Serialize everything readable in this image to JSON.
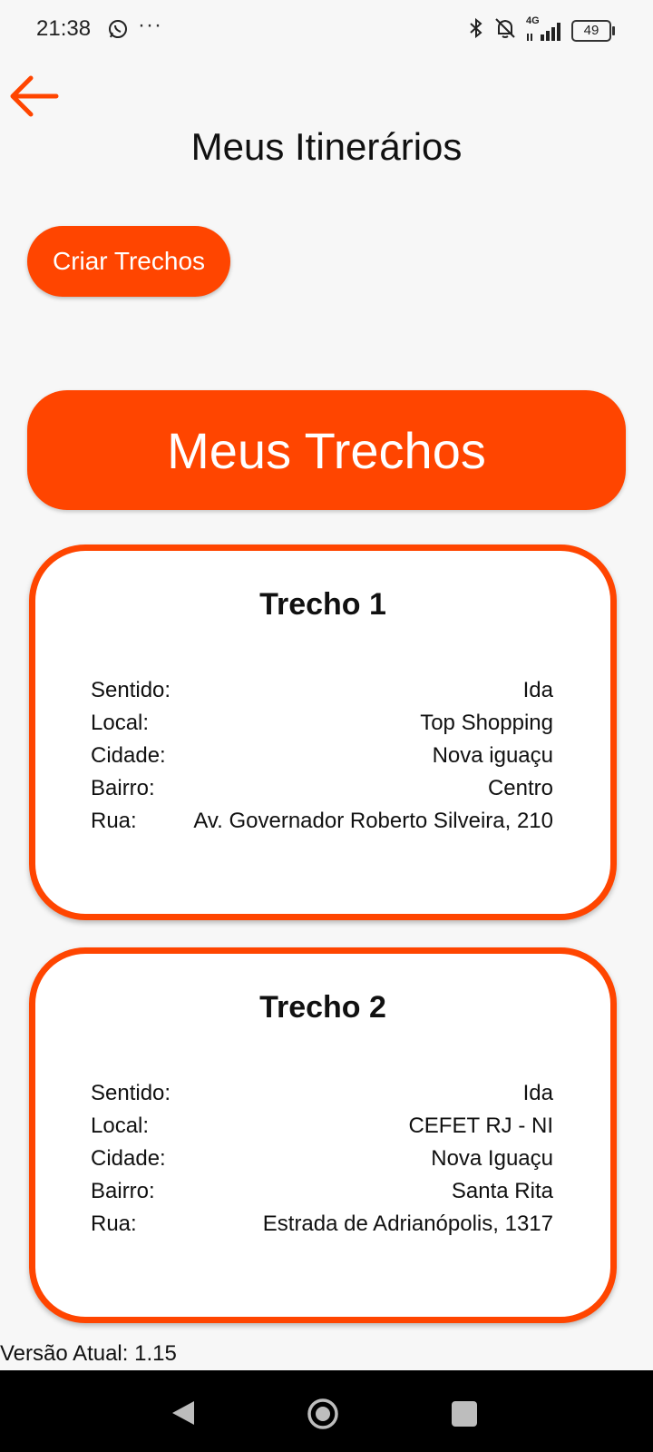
{
  "status_bar": {
    "time": "21:38",
    "more": "···",
    "network": "4G",
    "battery": "49",
    "icons": [
      "whatsapp-icon",
      "bluetooth-icon",
      "bell-off-icon",
      "signal-icon",
      "battery-icon"
    ]
  },
  "header": {
    "back_icon": "arrow-left-icon",
    "title": "Meus Itinerários"
  },
  "actions": {
    "create_label": "Criar Trechos"
  },
  "section": {
    "title": "Meus Trechos"
  },
  "cards": [
    {
      "title": "Trecho 1",
      "rows": [
        {
          "label": "Sentido:",
          "value": "Ida"
        },
        {
          "label": "Local:",
          "value": "Top Shopping"
        },
        {
          "label": "Cidade:",
          "value": "Nova iguaçu"
        },
        {
          "label": "Bairro:",
          "value": "Centro"
        },
        {
          "label": "Rua:",
          "value": "Av. Governador Roberto Silveira, 210"
        }
      ]
    },
    {
      "title": "Trecho 2",
      "rows": [
        {
          "label": "Sentido:",
          "value": "Ida"
        },
        {
          "label": "Local:",
          "value": "CEFET RJ - NI"
        },
        {
          "label": "Cidade:",
          "value": "Nova Iguaçu"
        },
        {
          "label": "Bairro:",
          "value": "Santa Rita"
        },
        {
          "label": "Rua:",
          "value": "Estrada de Adrianópolis, 1317"
        }
      ]
    }
  ],
  "footer": {
    "version": "Versão Atual: 1.15"
  },
  "colors": {
    "accent": "#ff4500",
    "background": "#f7f7f7"
  }
}
